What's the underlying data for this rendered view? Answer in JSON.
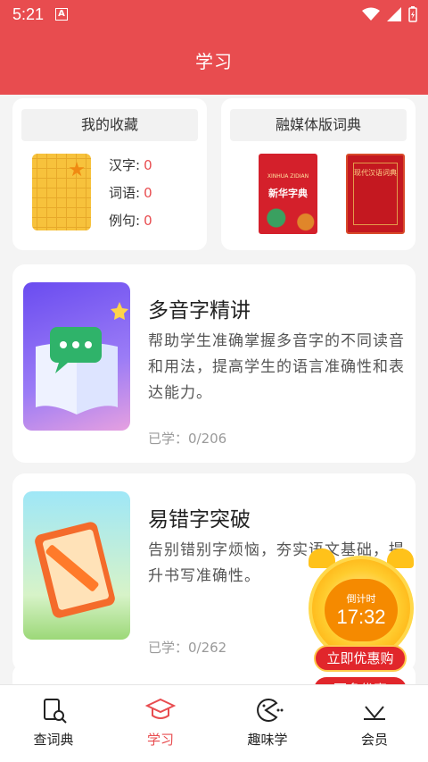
{
  "status_bar": {
    "time": "5:21",
    "notif_icon": "A"
  },
  "header": {
    "title": "学习"
  },
  "favorites": {
    "title": "我的收藏",
    "items": [
      {
        "label": "汉字:",
        "count": "0"
      },
      {
        "label": "词语:",
        "count": "0"
      },
      {
        "label": "例句:",
        "count": "0"
      }
    ]
  },
  "dictionary": {
    "title": "融媒体版词典",
    "book1_pinyin": "XINHUA ZIDIAN",
    "book1_title": "新华字典",
    "book2_title": "现代汉语词典"
  },
  "features": [
    {
      "title": "多音字精讲",
      "desc": "帮助学生准确掌握多音字的不同读音和用法，提高学生的语言准确性和表达能力。",
      "progress": "已学：0/206"
    },
    {
      "title": "易错字突破",
      "desc": "告别错别字烦恼，夯实语文基础，提升书写准确性。",
      "progress": "已学：0/262"
    }
  ],
  "promo": {
    "countdown_label": "倒计时",
    "countdown": "17:32",
    "buy_label": "立即优惠购",
    "more_label": "更多优惠"
  },
  "tabs": [
    {
      "label": "查词典",
      "icon": "dictionary-search-icon"
    },
    {
      "label": "学习",
      "icon": "graduation-cap-icon"
    },
    {
      "label": "趣味学",
      "icon": "pacman-icon"
    },
    {
      "label": "会员",
      "icon": "vip-icon"
    }
  ],
  "colors": {
    "primary": "#e84c4f",
    "accent_orange": "#f7c23c"
  }
}
